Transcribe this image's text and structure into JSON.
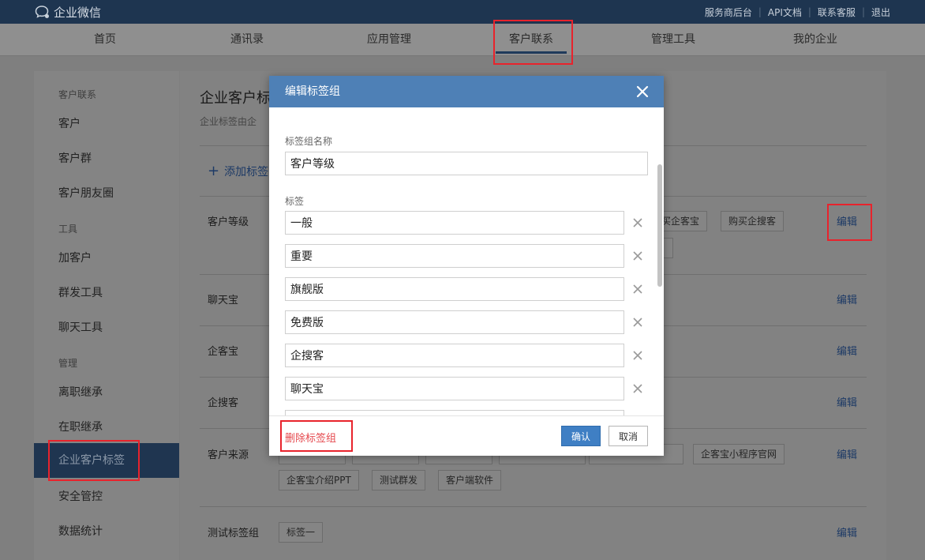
{
  "app": {
    "logo_text": "企业微信",
    "top_links": [
      "服务商后台",
      "API文档",
      "联系客服",
      "退出"
    ]
  },
  "nav": {
    "items": [
      "首页",
      "通讯录",
      "应用管理",
      "客户联系",
      "管理工具",
      "我的企业"
    ],
    "active": "客户联系"
  },
  "sidebar": {
    "groups": [
      {
        "title": "客户联系",
        "items": [
          "客户",
          "客户群",
          "客户朋友圈"
        ]
      },
      {
        "title": "工具",
        "items": [
          "加客户",
          "群发工具",
          "聊天工具"
        ]
      },
      {
        "title": "管理",
        "items": [
          "离职继承",
          "在职继承",
          "企业客户标签",
          "安全管控",
          "数据统计"
        ]
      }
    ],
    "active": "企业客户标签"
  },
  "main": {
    "title": "企业客户标",
    "description": "企业标签由企",
    "add_tag": "添加标签",
    "edit_label": "编辑",
    "rows": [
      {
        "name": "客户等级",
        "chips": [
          "买企客宝",
          "购买企搜客"
        ]
      },
      {
        "name": "聊天宝",
        "chips": []
      },
      {
        "name": "企客宝",
        "chips": []
      },
      {
        "name": "企搜客",
        "chips": []
      },
      {
        "name": "客户来源",
        "chips": [
          "企客宝小程序官网",
          "企客宝介绍PPT",
          "测试群发",
          "客户端软件"
        ]
      },
      {
        "name": "测试标签组",
        "chips": [
          "标签一"
        ]
      }
    ]
  },
  "modal": {
    "title": "编辑标签组",
    "group_name_label": "标签组名称",
    "group_name_value": "客户等级",
    "tags_label": "标签",
    "tags": [
      "一般",
      "重要",
      "旗舰版",
      "免费版",
      "企搜客",
      "聊天宝"
    ],
    "delete_group": "删除标签组",
    "confirm": "确认",
    "cancel": "取消"
  },
  "colors": {
    "topbar": "#1e3550",
    "modal_header": "#4e80b6",
    "confirm_button": "#3f7fc4",
    "delete_text": "#e5484d",
    "highlight": "#e8232c"
  }
}
